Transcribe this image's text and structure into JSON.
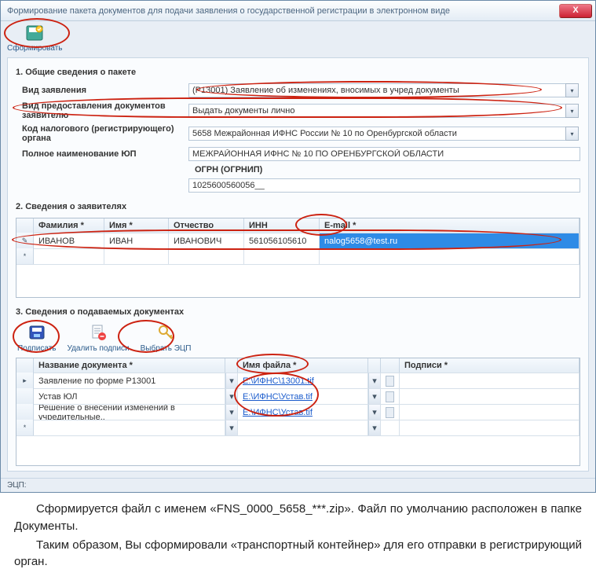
{
  "window": {
    "title": "Формирование пакета документов для подачи заявления о государственной регистрации в электронном виде",
    "close": "X"
  },
  "toolbar": {
    "form_label": "Сформировать"
  },
  "section1": {
    "title": "1. Общие сведения о пакете",
    "labels": {
      "vid_zayav": "Вид заявления",
      "vid_pred": "Вид предоставления документов заявителю",
      "kod_nalog": "Код налогового (регистрирующего) органа",
      "poln_naim": "Полное наименование ЮП",
      "ogrn": "ОГРН (ОГРНИП)"
    },
    "values": {
      "vid_zayav": "(Р13001) Заявление об изменениях, вносимых в учред документы",
      "vid_pred": "Выдать документы лично",
      "kod_nalog": "5658 Межрайонная ИФНС России № 10 по Оренбургской области",
      "poln_naim": "МЕЖРАЙОННАЯ ИФНС № 10 ПО ОРЕНБУРГСКОЙ ОБЛАСТИ",
      "ogrn": "1025600560056__"
    }
  },
  "section2": {
    "title": "2. Сведения о заявителях",
    "headers": {
      "fam": "Фамилия *",
      "name": "Имя *",
      "otch": "Отчество",
      "inn": "ИНН",
      "email": "E-mail *"
    },
    "row": {
      "fam": "ИВАНОВ",
      "name": "ИВАН",
      "otch": "ИВАНОВИЧ",
      "inn": "561056105610",
      "email": "nalog5658@test.ru"
    }
  },
  "section3": {
    "title": "3. Сведения о подаваемых документах",
    "tools": {
      "sign": "Подписать",
      "del": "Удалить подписи",
      "choose": "Выбрать ЭЦП"
    },
    "headers": {
      "name": "Название документа *",
      "file": "Имя файла *",
      "sig": "Подписи *"
    },
    "rows": [
      {
        "name": "Заявление по форме Р13001",
        "file": "E:\\ИФНС\\13001.tif"
      },
      {
        "name": "Устав ЮЛ",
        "file": "E:\\ИФНС\\Устав.tif"
      },
      {
        "name": "Решение о внесении изменений в учредительные..",
        "file": "E:\\ИФНС\\Устав.tif"
      }
    ]
  },
  "statusbar": {
    "text": "ЭЦП:"
  },
  "caption": {
    "p1": "Сформируется файл с именем «FNS_0000_5658_***.zip». Файл по умолчанию расположен в папке Документы.",
    "p2": "Таким образом, Вы сформировали «транспортный контейнер» для его отправки в регистрирующий орган."
  }
}
